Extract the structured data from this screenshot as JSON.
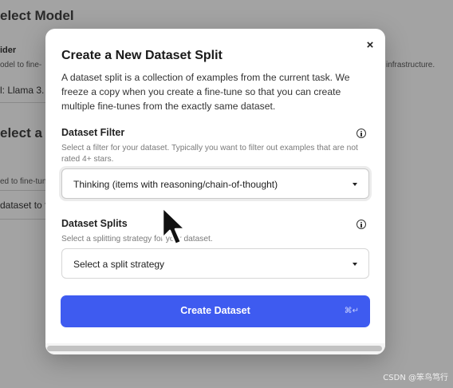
{
  "background": {
    "heading_1": "elect Model",
    "provider_label": "ider",
    "provider_desc": "odel to fine-",
    "right_desc": "infrastructure.",
    "model_value": "l: Llama 3.",
    "heading_2": "elect a D",
    "split_desc": "ed to fine-tune",
    "split_value": "dataset to fin"
  },
  "modal": {
    "title": "Create a New Dataset Split",
    "close_label": "×",
    "description": "A dataset split is a collection of examples from the current task. We freeze a copy when you create a fine-tune so that you can create multiple fine-tunes from the exactly same dataset.",
    "filter": {
      "label": "Dataset Filter",
      "help": "Select a filter for your dataset. Typically you want to filter out examples that are not rated 4+ stars.",
      "value": "Thinking (items with reasoning/chain-of-thought)"
    },
    "splits": {
      "label": "Dataset Splits",
      "help": "Select a splitting strategy for your dataset.",
      "value": "Select a split strategy"
    },
    "create_button": {
      "label": "Create Dataset",
      "shortcut": "⌘↵"
    }
  },
  "watermark": "CSDN @笨鸟笃行"
}
